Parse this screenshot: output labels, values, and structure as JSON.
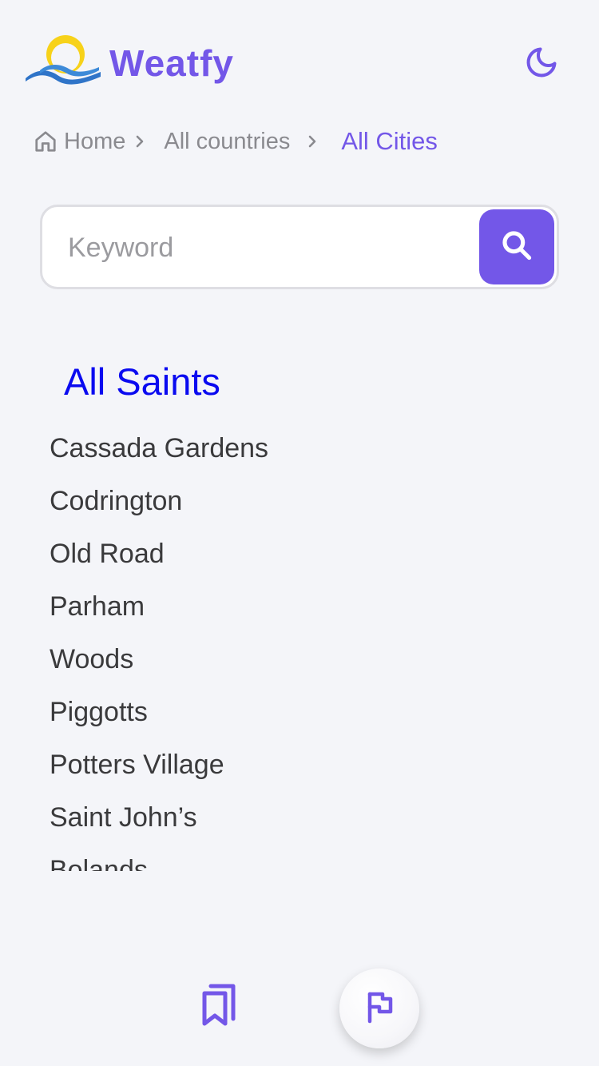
{
  "header": {
    "brand": "Weatfy",
    "logo_icon": "sun-over-waves-logo",
    "theme_toggle_icon": "moon-icon"
  },
  "breadcrumb": {
    "items": [
      {
        "label": "Home",
        "icon": "home-icon"
      },
      {
        "label": "All countries"
      },
      {
        "label": "All Cities"
      }
    ]
  },
  "search": {
    "placeholder": "Keyword",
    "value": "",
    "button_icon": "search-icon"
  },
  "region": {
    "title": "All Saints",
    "cities": [
      "Cassada Gardens",
      "Codrington",
      "Old Road",
      "Parham",
      "Woods",
      "Piggotts",
      "Potters Village",
      "Saint John’s",
      "Bolands"
    ]
  },
  "bottom_nav": {
    "items": [
      {
        "icon": "bookmarks-icon"
      },
      {
        "icon": "flag-icon",
        "active": true
      }
    ]
  },
  "colors": {
    "accent": "#7357e8",
    "background": "#f4f5f9",
    "region_title": "#0a0af0",
    "text": "#3a3a3c",
    "muted": "#8a8a8f",
    "logo_sun": "#f7d21a",
    "logo_wave": "#2f74c8"
  }
}
